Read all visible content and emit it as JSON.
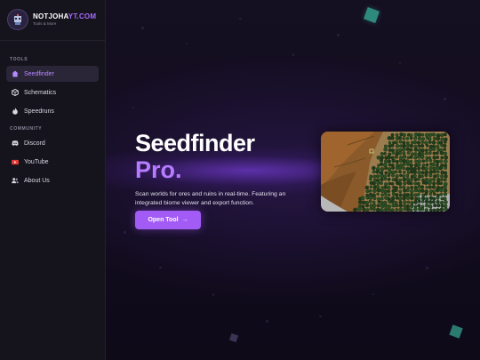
{
  "brand": {
    "name_prefix": "NOTJOHA",
    "name_highlight": "YT.COM",
    "subtitle": "Tools & More"
  },
  "sidebar": {
    "sections": [
      {
        "label": "TOOLS"
      },
      {
        "label": "COMMUNITY"
      }
    ],
    "items": [
      {
        "label": "Seedfinder",
        "icon": "home-icon",
        "active": true
      },
      {
        "label": "Schematics",
        "icon": "cube-icon"
      },
      {
        "label": "Speedruns",
        "icon": "flame-icon"
      },
      {
        "label": "Discord",
        "icon": "discord-icon"
      },
      {
        "label": "YouTube",
        "icon": "youtube-icon"
      },
      {
        "label": "About Us",
        "icon": "users-icon"
      }
    ]
  },
  "hero": {
    "title": "Seedfinder",
    "title_accent": "Pro.",
    "description": "Scan worlds for ores and ruins in real-time. Featuring an integrated biome viewer and export function.",
    "button_label": "Open Tool",
    "button_icon": "arrow-right-icon"
  },
  "colors": {
    "accent": "#a25cf5",
    "accent_text": "#b77bff",
    "sidebar_bg": "#15131b",
    "main_bg": "#120c1e"
  }
}
